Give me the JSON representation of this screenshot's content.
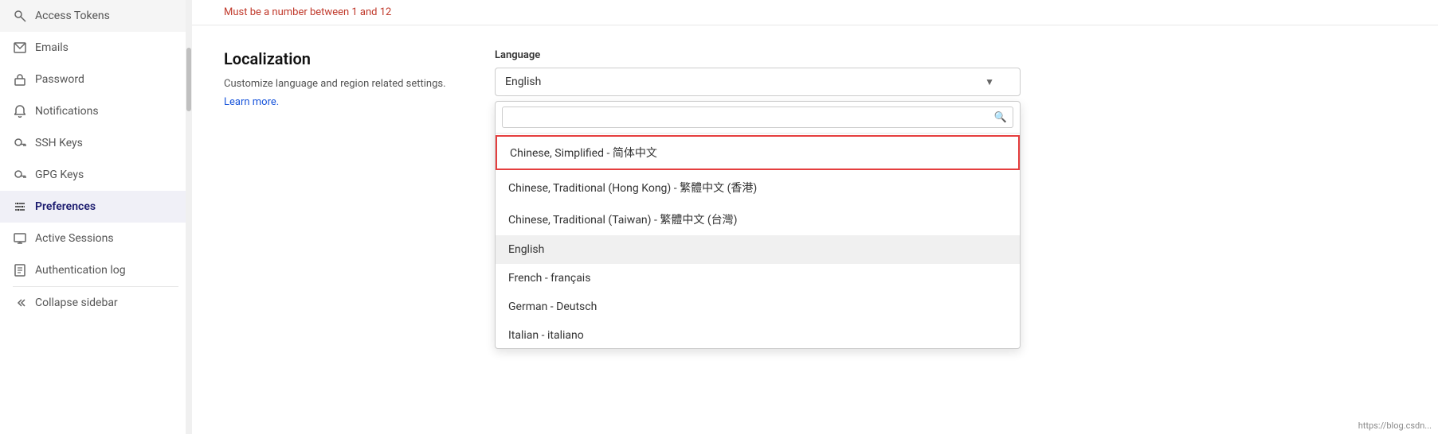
{
  "sidebar": {
    "items": [
      {
        "id": "access-tokens",
        "label": "Access Tokens",
        "icon": "🔑",
        "active": false
      },
      {
        "id": "emails",
        "label": "Emails",
        "icon": "✉",
        "active": false
      },
      {
        "id": "password",
        "label": "Password",
        "icon": "🔒",
        "active": false
      },
      {
        "id": "notifications",
        "label": "Notifications",
        "icon": "🔔",
        "active": false
      },
      {
        "id": "ssh-keys",
        "label": "SSH Keys",
        "icon": "🔑",
        "active": false
      },
      {
        "id": "gpg-keys",
        "label": "GPG Keys",
        "icon": "🔑",
        "active": false
      },
      {
        "id": "preferences",
        "label": "Preferences",
        "icon": "⚙",
        "active": true
      },
      {
        "id": "active-sessions",
        "label": "Active Sessions",
        "icon": "🖥",
        "active": false
      },
      {
        "id": "authentication-log",
        "label": "Authentication log",
        "icon": "📋",
        "active": false
      }
    ],
    "collapse_label": "Collapse sidebar"
  },
  "main": {
    "top_hint": "Must be a number between 1 and 12",
    "section": {
      "title": "Localization",
      "description": "Customize language and region related settings.",
      "learn_more": "Learn more."
    },
    "language_field": {
      "label": "Language",
      "selected_value": "English",
      "search_placeholder": ""
    },
    "dropdown_items": [
      {
        "id": "chinese-simplified",
        "label": "Chinese, Simplified - 简体中文",
        "highlighted": true,
        "selected": false
      },
      {
        "id": "chinese-traditional-hk",
        "label": "Chinese, Traditional (Hong Kong) - 繁體中文 (香港)",
        "highlighted": false,
        "selected": false
      },
      {
        "id": "chinese-traditional-tw",
        "label": "Chinese, Traditional (Taiwan) - 繁體中文 (台灣)",
        "highlighted": false,
        "selected": false
      },
      {
        "id": "english",
        "label": "English",
        "highlighted": false,
        "selected": true
      },
      {
        "id": "french",
        "label": "French - français",
        "highlighted": false,
        "selected": false
      },
      {
        "id": "german",
        "label": "German - Deutsch",
        "highlighted": false,
        "selected": false
      },
      {
        "id": "italian",
        "label": "Italian - italiano",
        "highlighted": false,
        "selected": false
      }
    ]
  },
  "url_hint": "https://blog.csdn..."
}
